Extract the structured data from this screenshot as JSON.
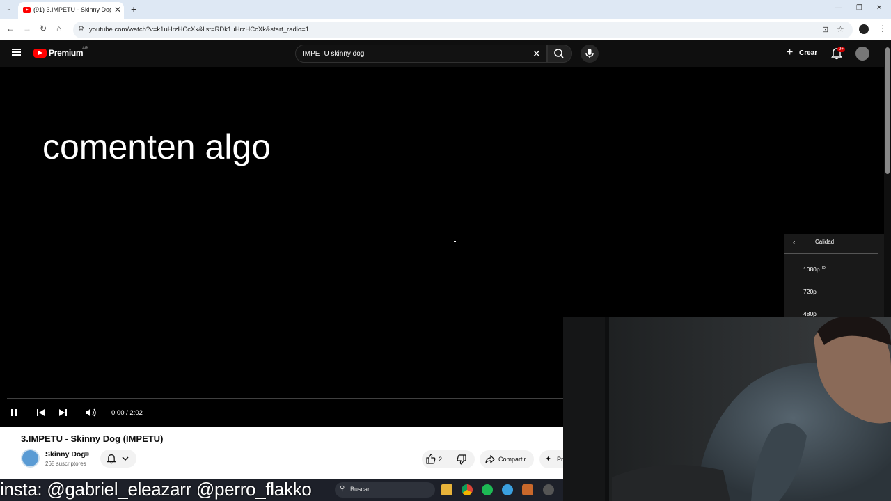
{
  "browser": {
    "tab_title": "(91) 3.IMPETU - Skinny Dog (IMPETU)",
    "url": "youtube.com/watch?v=k1uHrzHCcXk&list=RDk1uHrzHCcXk&start_radio=1"
  },
  "header": {
    "brand": "Premium",
    "region": "AR",
    "search_value": "IMPETU skinny dog",
    "create_label": "Crear",
    "notification_badge": "9+"
  },
  "player": {
    "caption": "comenten algo",
    "time": "0:00 / 2:02",
    "progress_fraction": 0.0,
    "quality_menu": {
      "title": "Calidad",
      "options": [
        "1080p",
        "720p",
        "480p"
      ],
      "hd_badge": "HD"
    }
  },
  "video": {
    "title": "3.IMPETU - Skinny Dog (IMPETU)",
    "channel": "Skinny Dog",
    "subscribers": "268 suscriptores",
    "likes": "2",
    "share_label": "Compartir",
    "remix_label": "Pr"
  },
  "taskbar": {
    "search_label": "Buscar"
  },
  "overlay": {
    "text": "insta: @gabriel_eleazarr @perro_flakko"
  },
  "colors": {
    "youtube_red": "#ff0000",
    "background": "#0f0f0f"
  }
}
